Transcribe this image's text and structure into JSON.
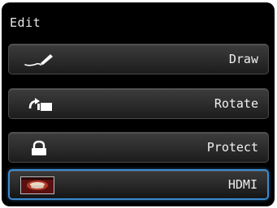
{
  "screen": {
    "title": "Edit"
  },
  "menu": {
    "items": [
      {
        "label": "Draw",
        "icon": "draw-pen-icon"
      },
      {
        "label": "Rotate",
        "icon": "rotate-icon"
      },
      {
        "label": "Protect",
        "icon": "lock-icon"
      },
      {
        "label": "HDMI",
        "icon": "hdmi-preview-thumbnail",
        "selected": true
      }
    ]
  },
  "colors": {
    "selection_border": "#3a8bd0",
    "panel_background": "#000000",
    "text": "#f0f0f0"
  }
}
